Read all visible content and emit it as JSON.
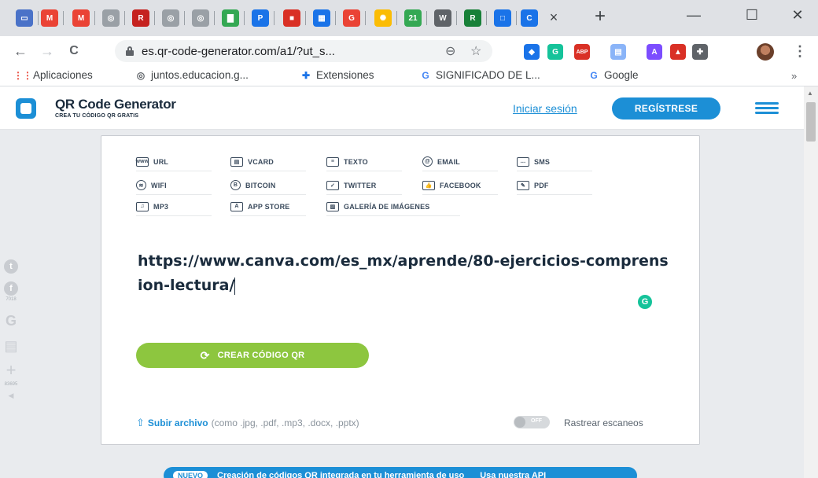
{
  "browser": {
    "tab_favicons": [
      {
        "name": "classroom",
        "color": "#4a72c8",
        "glyph": "▭"
      },
      {
        "name": "gmail-104",
        "color": "#ea4335",
        "glyph": "M"
      },
      {
        "name": "gmail",
        "color": "#ea4335",
        "glyph": "M"
      },
      {
        "name": "globe",
        "color": "#9aa0a6",
        "glyph": "◎"
      },
      {
        "name": "r-site",
        "color": "#c5221f",
        "glyph": "R"
      },
      {
        "name": "globe",
        "color": "#9aa0a6",
        "glyph": "◎"
      },
      {
        "name": "globe",
        "color": "#9aa0a6",
        "glyph": "◎"
      },
      {
        "name": "chart-site",
        "color": "#34a853",
        "glyph": "▇"
      },
      {
        "name": "p-site",
        "color": "#1a73e8",
        "glyph": "P"
      },
      {
        "name": "red-site",
        "color": "#d93025",
        "glyph": "■"
      },
      {
        "name": "blue-site",
        "color": "#1a73e8",
        "glyph": "▦"
      },
      {
        "name": "g-red-site",
        "color": "#ea4335",
        "glyph": "G"
      },
      {
        "name": "colorful-site",
        "color": "#fbbc04",
        "glyph": "✺"
      },
      {
        "name": "21-site",
        "color": "#34a853",
        "glyph": "21"
      },
      {
        "name": "wikipedia",
        "color": "#5f6368",
        "glyph": "W"
      },
      {
        "name": "pr-site",
        "color": "#188038",
        "glyph": "R"
      },
      {
        "name": "blue-square-site",
        "color": "#1a73e8",
        "glyph": "□"
      },
      {
        "name": "canva",
        "color": "#1a73e8",
        "glyph": "C"
      }
    ],
    "tab_close": "×",
    "new_tab": "+",
    "window_minimize": "—",
    "window_maximize": "☐",
    "window_close": "✕",
    "nav_back": "←",
    "nav_forward": "→",
    "nav_reload": "C",
    "url": "es.qr-code-generator.com/a1/?ut_s...",
    "omni_icons": [
      "⊖",
      "☆"
    ],
    "extensions": [
      {
        "name": "cap-extension",
        "color": "#1a73e8",
        "glyph": "◆"
      },
      {
        "name": "grammarly-extension",
        "color": "#15c39a",
        "glyph": "G"
      },
      {
        "name": "abp-extension",
        "color": "#d93025",
        "glyph": "ABP"
      },
      {
        "name": "docs-extension",
        "color": "#8ab4f8",
        "glyph": "▤"
      },
      {
        "name": "a-extension",
        "color": "#7c4dff",
        "glyph": "A"
      },
      {
        "name": "red-extension",
        "color": "#d93025",
        "glyph": "▲"
      },
      {
        "name": "puzzle-extension",
        "color": "#5f6368",
        "glyph": "✚"
      }
    ],
    "menu": "⋮",
    "bookmarks": [
      {
        "label": "Aplicaciones",
        "icon": "apps-grid-icon",
        "glyph": "⋮⋮",
        "color": "#ea4335"
      },
      {
        "label": "juntos.educacion.g...",
        "icon": "globe-icon",
        "glyph": "◎",
        "color": "#5f6368"
      },
      {
        "label": "Extensiones",
        "icon": "puzzle-icon",
        "glyph": "✚",
        "color": "#1a73e8"
      },
      {
        "label": "SIGNIFICADO DE L...",
        "icon": "google-icon",
        "glyph": "G",
        "color": "#4285f4"
      },
      {
        "label": "Google",
        "icon": "google-icon",
        "glyph": "G",
        "color": "#4285f4"
      }
    ],
    "bookmarks_more": "»"
  },
  "header": {
    "logo_title": "QR Code Generator",
    "logo_tagline": "CREA TU CÓDIGO QR GRATIS",
    "login": "Iniciar sesión",
    "register": "REGÍSTRESE"
  },
  "social": {
    "twitter_glyph": "t",
    "facebook_glyph": "f",
    "facebook_count": "7018",
    "google_glyph": "G",
    "print_glyph": "▤",
    "share_glyph": "+",
    "share_count": "83695",
    "collapse_glyph": "◀"
  },
  "qr_types": [
    {
      "label": "URL",
      "glyph": "www",
      "icon": "url-icon"
    },
    {
      "label": "VCARD",
      "glyph": "▤",
      "icon": "vcard-icon"
    },
    {
      "label": "TEXTO",
      "glyph": "≡",
      "icon": "text-icon"
    },
    {
      "label": "EMAIL",
      "glyph": "@",
      "icon": "email-icon"
    },
    {
      "label": "SMS",
      "glyph": "…",
      "icon": "sms-icon"
    },
    {
      "label": "WIFI",
      "glyph": "≋",
      "icon": "wifi-icon"
    },
    {
      "label": "BITCOIN",
      "glyph": "B",
      "icon": "bitcoin-icon"
    },
    {
      "label": "TWITTER",
      "glyph": "✓",
      "icon": "twitter-icon"
    },
    {
      "label": "FACEBOOK",
      "glyph": "👍",
      "icon": "facebook-icon"
    },
    {
      "label": "PDF",
      "glyph": "✎",
      "icon": "pdf-icon"
    },
    {
      "label": "MP3",
      "glyph": "♫",
      "icon": "mp3-icon"
    },
    {
      "label": "APP STORE",
      "glyph": "A",
      "icon": "app-store-icon"
    },
    {
      "label": "GALERÍA DE IMÁGENES",
      "glyph": "▨",
      "icon": "image-gallery-icon"
    }
  ],
  "editor": {
    "url_value": "https://www.canva.com/es_mx/aprende/80-ejercicios-comprension-lectura/",
    "grammarly_glyph": "G",
    "create_button": "CREAR CÓDIGO QR",
    "create_icon": "⟳",
    "upload_icon": "⇧",
    "upload_link": "Subir archivo",
    "upload_hint": "(como .jpg, .pdf, .mp3, .docx, .pptx)",
    "toggle_state": "OFF",
    "tracking_label": "Rastrear escaneos"
  },
  "banner": {
    "badge": "NUEVO",
    "text": "Creación de códigos QR integrada en tu herramienta de uso",
    "cta": "Usa nuestra API"
  },
  "colors": {
    "brand_blue": "#1c8fd6",
    "create_green": "#8dc63f",
    "navy_text": "#1a2b3c"
  }
}
